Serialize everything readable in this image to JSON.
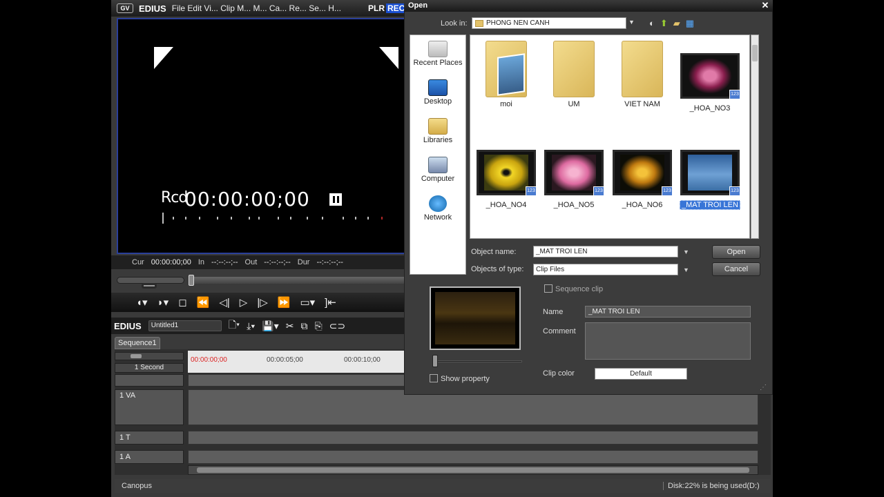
{
  "app": {
    "title_brand": "EDIUS",
    "menu": "File Edit Vi... Clip M... M... Ca... Re... Se... H...",
    "logo": "GV",
    "plr": "PLR",
    "rec": "REC"
  },
  "monitor": {
    "rcd_label": "Rcd",
    "timecode": "00:00:00;00"
  },
  "timecodes": {
    "cur_label": "Cur",
    "cur": "00:00:00;00",
    "in_label": "In",
    "in": "--:--:--;--",
    "out_label": "Out",
    "out": "--:--:--;--",
    "dur_label": "Dur",
    "dur": "--:--:--;--"
  },
  "editbar": {
    "brand": "EDIUS",
    "project": "Untitled1"
  },
  "timeline": {
    "sequence_tab": "Sequence1",
    "zoom": "1 Second",
    "ruler": [
      "00:00:00;00",
      "00:00:05;00",
      "00:00:10;00"
    ],
    "tracks": [
      {
        "name": "1 VA"
      },
      {
        "name": "1 T"
      },
      {
        "name": "1 A"
      }
    ]
  },
  "status": {
    "left": "Canopus",
    "disk": "Disk:22% is being used(D:)"
  },
  "dialog": {
    "title": "Open",
    "close": "✕",
    "look_in_label": "Look in:",
    "look_in_value": "PHONG NEN CANH",
    "places": [
      "Recent Places",
      "Desktop",
      "Libraries",
      "Computer",
      "Network"
    ],
    "files": [
      {
        "name": "moi",
        "type": "folder"
      },
      {
        "name": "UM",
        "type": "folder"
      },
      {
        "name": "VIET NAM",
        "type": "folder"
      },
      {
        "name": "_HOA_NO3",
        "type": "clip",
        "color": "#c9478a"
      },
      {
        "name": "_HOA_NO4",
        "type": "clip",
        "color": "#e6c61c"
      },
      {
        "name": "_HOA_NO5",
        "type": "clip",
        "color": "#e57bb0"
      },
      {
        "name": "_HOA_NO6",
        "type": "clip",
        "color": "#e0a020"
      },
      {
        "name": "_MAT TROI LEN",
        "type": "clip",
        "color": "#4f88c6",
        "selected": true
      }
    ],
    "object_name_label": "Object name:",
    "object_name": "_MAT TROI LEN",
    "object_type_label": "Objects of type:",
    "object_type": "Clip Files",
    "open_button": "Open",
    "cancel_button": "Cancel",
    "sequence_clip_label": "Sequence clip",
    "show_property_label": "Show property",
    "name_label": "Name",
    "name_value": "_MAT TROI LEN",
    "comment_label": "Comment",
    "clip_color_label": "Clip color",
    "clip_color_value": "Default"
  }
}
